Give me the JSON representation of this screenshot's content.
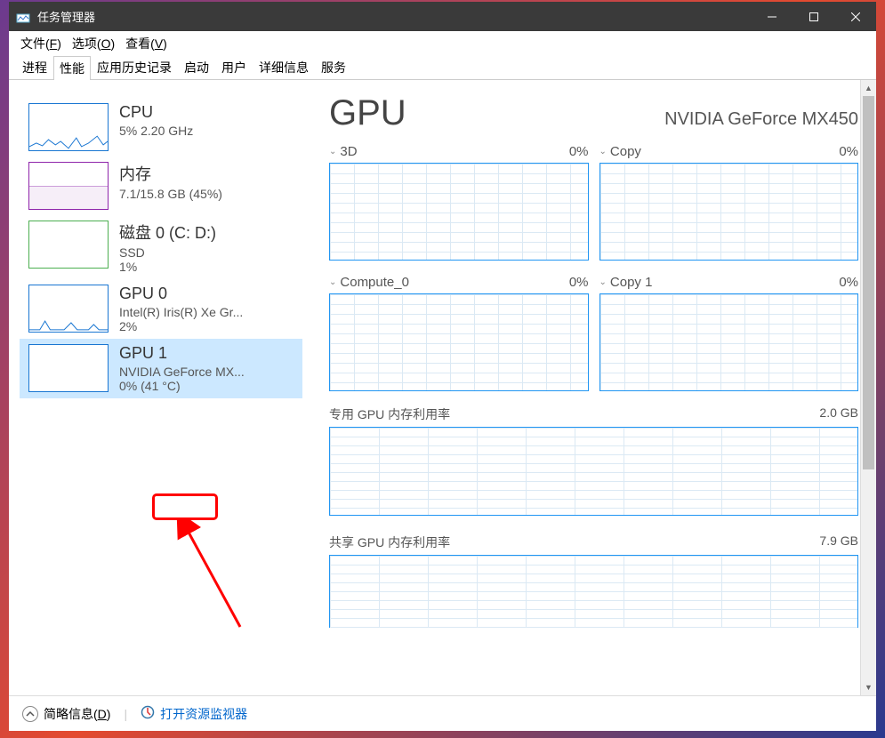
{
  "window": {
    "title": "任务管理器"
  },
  "menubar": [
    {
      "label": "文件",
      "hotkey": "F"
    },
    {
      "label": "选项",
      "hotkey": "O"
    },
    {
      "label": "查看",
      "hotkey": "V"
    }
  ],
  "tabs": {
    "processes": "进程",
    "performance": "性能",
    "history": "应用历史记录",
    "startup": "启动",
    "users": "用户",
    "details": "详细信息",
    "services": "服务"
  },
  "sidebar": {
    "cpu": {
      "title": "CPU",
      "sub": "5%  2.20 GHz"
    },
    "memory": {
      "title": "内存",
      "sub": "7.1/15.8 GB (45%)"
    },
    "disk": {
      "title": "磁盘 0 (C: D:)",
      "sub1": "SSD",
      "sub2": "1%"
    },
    "gpu0": {
      "title": "GPU 0",
      "sub1": "Intel(R) Iris(R) Xe Gr...",
      "sub2": "2%"
    },
    "gpu1": {
      "title": "GPU 1",
      "sub1": "NVIDIA GeForce MX...",
      "sub2_pre": "0% ",
      "sub2_temp": "(41 °C)"
    }
  },
  "main": {
    "title": "GPU",
    "subtitle": "NVIDIA GeForce MX450",
    "charts": {
      "c1": {
        "label": "3D",
        "value": "0%"
      },
      "c2": {
        "label": "Copy",
        "value": "0%"
      },
      "c3": {
        "label": "Compute_0",
        "value": "0%"
      },
      "c4": {
        "label": "Copy 1",
        "value": "0%"
      }
    },
    "dedicated": {
      "label": "专用 GPU 内存利用率",
      "max": "2.0 GB"
    },
    "shared": {
      "label": "共享 GPU 内存利用率",
      "max": "7.9 GB"
    }
  },
  "footer": {
    "brief": "简略信息",
    "brief_hotkey": "D",
    "monitor": "打开资源监视器"
  }
}
